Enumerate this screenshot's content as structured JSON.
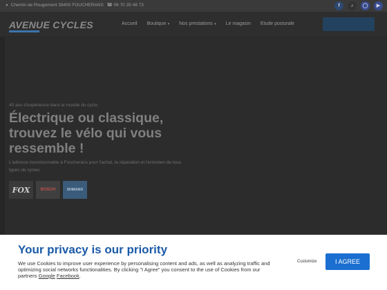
{
  "topbar": {
    "address": "Chemin de Rougement 39400 FOUCHERANS",
    "phone": "06 70 35 48 73",
    "social_icons": [
      "facebook-icon",
      "tiktok-icon",
      "instagram-icon",
      "youtube-icon"
    ]
  },
  "nav": {
    "logo": "AVENUE CYCLES",
    "items": [
      {
        "label": "Accueil"
      },
      {
        "label": "Boutique"
      },
      {
        "label": "Nos prestations"
      },
      {
        "label": "Le magasin"
      },
      {
        "label": "Etude posturale"
      }
    ],
    "cta_label": ""
  },
  "hero": {
    "eyebrow": "40 ans d'expérience dans le monde du cycle",
    "headline": "Électrique ou classique, trouvez le vélo qui vous ressemble !",
    "description": "L'adresse incontournable à Foucherans pour l'achat, la réparation et l'entretien de tous types de cycles.",
    "brands": [
      "FOX",
      "BOSCH",
      "SHIMANO"
    ]
  },
  "cookie": {
    "title": "Your privacy is our priority",
    "text_before": "We use Cookies to improve user experience by personalising content and ads, as well as analyzing traffic and optimizing social networks functionalities. By clicking \"I Agree\" you consent to the use of Cookies from our partners ",
    "link_google": "Google",
    "link_facebook": "Facebook",
    "text_after": ".",
    "customize_label": "Customize",
    "agree_label": "I AGREE"
  },
  "colors": {
    "brand_blue": "#1a5aa8",
    "button_blue": "#1a6fd0",
    "overlay_dark": "#2c2c2c"
  }
}
